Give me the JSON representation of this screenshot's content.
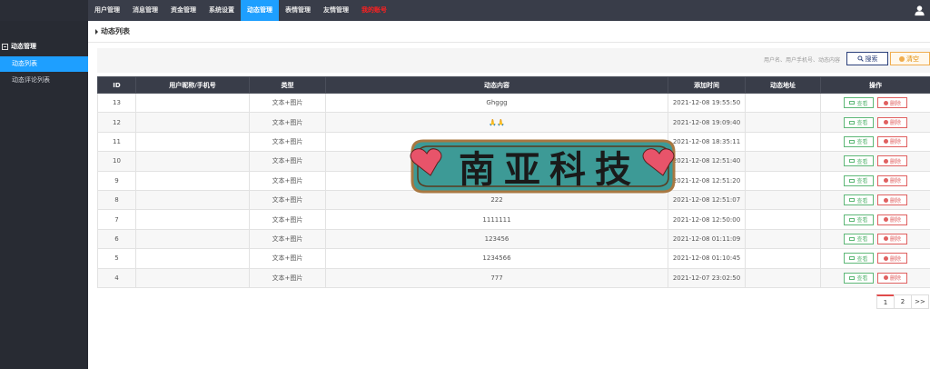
{
  "nav": {
    "items": [
      {
        "label": "用户管理",
        "active": false
      },
      {
        "label": "消息管理",
        "active": false
      },
      {
        "label": "资金管理",
        "active": false
      },
      {
        "label": "系统设置",
        "active": false
      },
      {
        "label": "动态管理",
        "active": true
      },
      {
        "label": "表情管理",
        "active": false
      },
      {
        "label": "友情管理",
        "active": false
      },
      {
        "label": "我的账号",
        "active": false
      }
    ],
    "user_icon": "user-icon"
  },
  "sidebar": {
    "group_title": "动态管理",
    "items": [
      {
        "label": "动态列表",
        "active": true
      },
      {
        "label": "动态评论列表",
        "active": false
      }
    ]
  },
  "breadcrumb": {
    "title": "动态列表"
  },
  "search": {
    "placeholder": "用户名、用户手机号、动态内容",
    "search_label": "搜索",
    "clear_label": "清空"
  },
  "table": {
    "headers": [
      "ID",
      "用户昵称/手机号",
      "类型",
      "动态内容",
      "添加时间",
      "动态地址",
      "操作"
    ],
    "view_label": "查看",
    "delete_label": "删除",
    "rows": [
      {
        "id": "13",
        "user": "",
        "type": "文本+图片",
        "content": "Ghggg",
        "time": "2021-12-08 19:55:50",
        "address": ""
      },
      {
        "id": "12",
        "user": "",
        "type": "文本+图片",
        "content": "🙏🙏",
        "time": "2021-12-08 19:09:40",
        "address": ""
      },
      {
        "id": "11",
        "user": "",
        "type": "文本+图片",
        "content": "",
        "time": "2021-12-08 18:35:11",
        "address": ""
      },
      {
        "id": "10",
        "user": "",
        "type": "文本+图片",
        "content": "",
        "time": "2021-12-08 12:51:40",
        "address": ""
      },
      {
        "id": "9",
        "user": "",
        "type": "文本+图片",
        "content": "",
        "time": "2021-12-08 12:51:20",
        "address": ""
      },
      {
        "id": "8",
        "user": "",
        "type": "文本+图片",
        "content": "222",
        "time": "2021-12-08 12:51:07",
        "address": ""
      },
      {
        "id": "7",
        "user": "",
        "type": "文本+图片",
        "content": "1111111",
        "time": "2021-12-08 12:50:00",
        "address": ""
      },
      {
        "id": "6",
        "user": "",
        "type": "文本+图片",
        "content": "123456",
        "time": "2021-12-08 01:11:09",
        "address": ""
      },
      {
        "id": "5",
        "user": "",
        "type": "文本+图片",
        "content": "1234566",
        "time": "2021-12-08 01:10:45",
        "address": ""
      },
      {
        "id": "4",
        "user": "",
        "type": "文本+图片",
        "content": "777",
        "time": "2021-12-07 23:02:50",
        "address": ""
      }
    ]
  },
  "pager": {
    "pages": [
      "1",
      "2",
      ">>"
    ],
    "current": "1"
  },
  "watermark": {
    "text": "南亚科技",
    "bg_color": "#3d9a96",
    "heart_color": "#e8546a"
  }
}
